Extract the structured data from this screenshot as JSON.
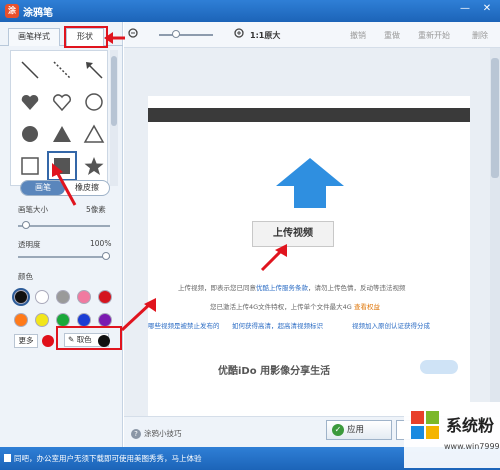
{
  "titlebar": {
    "logo": "涂",
    "title": "涂鸦笔",
    "minimize": "—",
    "close": "✕"
  },
  "left": {
    "tabs": [
      {
        "label": "画笔样式"
      },
      {
        "label": "形状"
      }
    ],
    "shapes": [
      "line-diagonal",
      "dashed-line",
      "arrow-line",
      "heart-filled",
      "heart-outline",
      "circle-outline",
      "circle-filled",
      "triangle-filled",
      "triangle-outline",
      "square-outline",
      "square-filled",
      "star-filled"
    ],
    "mode": {
      "pen": "画笔",
      "eraser": "橡皮擦"
    },
    "brush_size_label": "画笔大小",
    "brush_size_value": "5像素",
    "opacity_label": "透明度",
    "opacity_value": "100%",
    "color_label": "颜色",
    "colors": [
      "#111111",
      "#ffffff",
      "#9a9a9a",
      "#f07aa0",
      "#d4141e",
      "#ff7a1a",
      "#f2e61a",
      "#1aa83a",
      "#1a3cd4",
      "#7a1ab0"
    ],
    "more_label": "更多",
    "pick_label": "取色"
  },
  "toolbar": {
    "zoom_label": "1:1原大",
    "undo": "撤销",
    "redo": "重做",
    "restart": "重新开始",
    "delete": "删除"
  },
  "page": {
    "upload_label": "上传视频",
    "line1a": "上传视频，即表示您已同意",
    "line1b": "优酷上传服务条款",
    "line1c": "，请勿上传色情，反动等违法视频",
    "line2a": "您已激活上传4G文件特权，上传单个文件最大4G",
    "line2b": "查看权益",
    "link1": "哪些视频是被禁止发布的",
    "link2": "如何获得高清，超高清视频标识",
    "link3": "视频加入原创认证获得分成",
    "bold": "优酷iDo 用影像分享生活"
  },
  "bottom": {
    "tips": "涂鸦小技巧",
    "apply": "应用"
  },
  "status": {
    "text": "同吧，办公室用户无须下载即可使用美图秀秀，马上体验"
  },
  "watermark": {
    "title": "系统粉",
    "url": "www.win7999.com"
  }
}
